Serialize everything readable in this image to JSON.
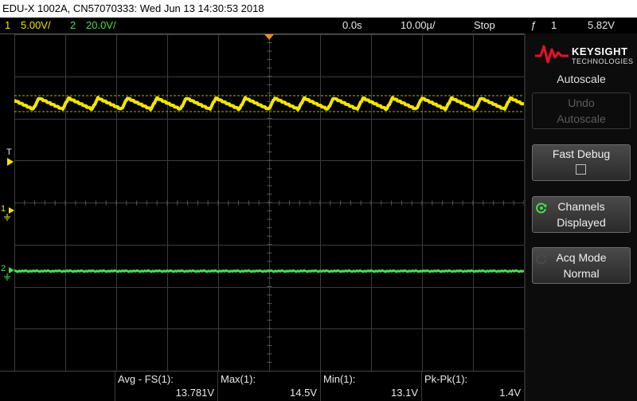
{
  "title": "EDU-X 1002A, CN57070333: Wed Jun 13 14:30:53 2018",
  "status": {
    "ch1_num": "1",
    "ch1_scale": "5.00V/",
    "ch2_num": "2",
    "ch2_scale": "20.0V/",
    "time_delay": "0.0s",
    "time_base": "10.00µ/",
    "run_state": "Stop",
    "trigger_symbol": "ƒ",
    "trigger_source": "1",
    "trigger_level": "5.82V"
  },
  "markers": {
    "trigger_level": "T",
    "ch1": "1",
    "ch2": "2"
  },
  "brand": {
    "name": "KEYSIGHT",
    "sub": "TECHNOLOGIES",
    "logo_color": "#e8102c"
  },
  "menu": {
    "title": "Autoscale",
    "undo_line1": "Undo",
    "undo_line2": "Autoscale",
    "fast_debug": "Fast Debug",
    "channels_line1": "Channels",
    "channels_line2": "Displayed",
    "acq_line1": "Acq Mode",
    "acq_line2": "Normal"
  },
  "measurements": [
    {
      "label": "Avg - FS(1):",
      "value": "13.781V"
    },
    {
      "label": "Max(1):",
      "value": "14.5V"
    },
    {
      "label": "Min(1):",
      "value": "13.1V"
    },
    {
      "label": "Pk-Pk(1):",
      "value": "1.4V"
    }
  ],
  "colors": {
    "ch1": "#f2e600",
    "ch2": "#45e04a",
    "trigger_marker": "#f28a1e",
    "grid": "#3c3c3c"
  }
}
